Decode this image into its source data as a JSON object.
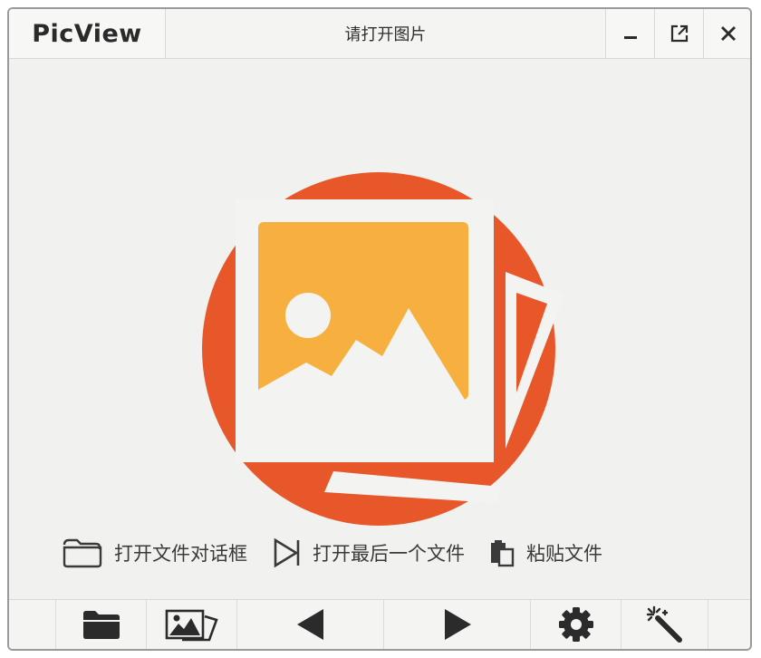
{
  "app": {
    "logo": "PicView",
    "title": "请打开图片"
  },
  "window_controls": [
    {
      "name": "minimize",
      "icon": "minimize-icon"
    },
    {
      "name": "fullscreen",
      "icon": "external-expand-icon"
    },
    {
      "name": "close",
      "icon": "close-icon"
    }
  ],
  "quick_actions": [
    {
      "label": "打开文件对话框",
      "icon": "folder-open-icon"
    },
    {
      "label": "打开最后一个文件",
      "icon": "play-outline-icon"
    },
    {
      "label": "粘贴文件",
      "icon": "paste-icon"
    }
  ],
  "bottom_toolbar": [
    {
      "name": "open-file",
      "icon": "folder-icon"
    },
    {
      "name": "gallery",
      "icon": "images-icon"
    },
    {
      "name": "previous",
      "icon": "arrow-left-icon"
    },
    {
      "name": "next",
      "icon": "arrow-right-icon"
    },
    {
      "name": "settings",
      "icon": "gear-icon"
    },
    {
      "name": "effects",
      "icon": "magic-wand-icon"
    }
  ],
  "colors": {
    "accent_red": "#e8572a",
    "accent_yellow": "#f7b03f",
    "background": "#f1f1ef",
    "icon_dark": "#2b2b2b"
  }
}
